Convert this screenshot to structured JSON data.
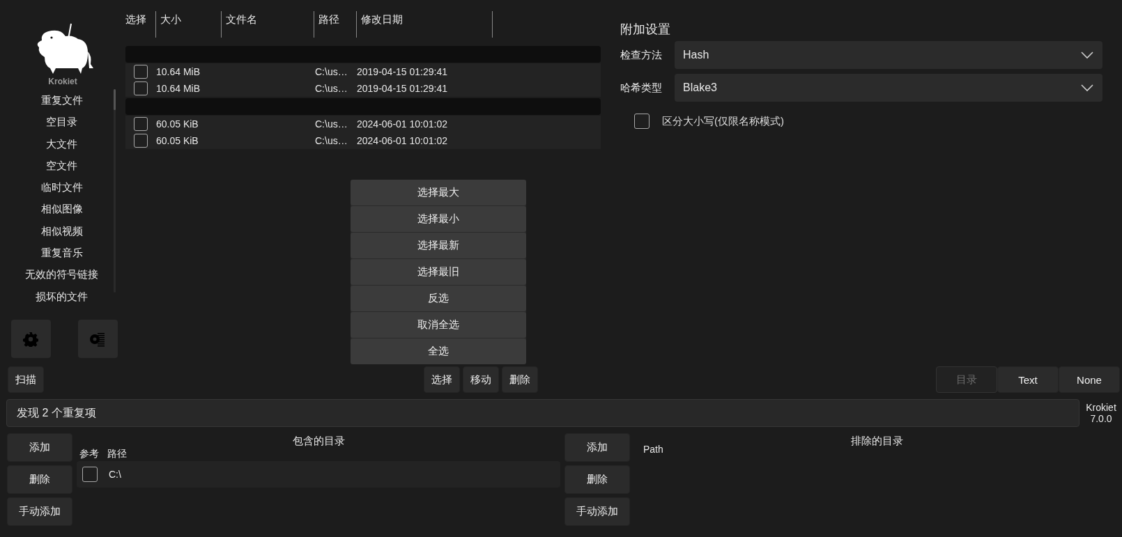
{
  "sidebar": {
    "logo_text": "Krokiet",
    "items": [
      {
        "label": "重复文件"
      },
      {
        "label": "空目录"
      },
      {
        "label": "大文件"
      },
      {
        "label": "空文件"
      },
      {
        "label": "临时文件"
      },
      {
        "label": "相似图像"
      },
      {
        "label": "相似视频"
      },
      {
        "label": "重复音乐"
      },
      {
        "label": "无效的符号链接"
      },
      {
        "label": "损坏的文件"
      }
    ]
  },
  "results_table": {
    "columns": [
      "选择",
      "大小",
      "文件名",
      "路径",
      "修改日期"
    ],
    "groups": [
      {
        "rows": [
          {
            "checked": false,
            "size": "10.64 MiB",
            "path": "C:\\us…",
            "modified": "2019-04-15 01:29:41"
          },
          {
            "checked": false,
            "size": "10.64 MiB",
            "path": "C:\\us…",
            "modified": "2019-04-15 01:29:41"
          }
        ]
      },
      {
        "rows": [
          {
            "checked": false,
            "size": "60.05 KiB",
            "path": "C:\\us…",
            "modified": "2024-06-01 10:01:02"
          },
          {
            "checked": false,
            "size": "60.05 KiB",
            "path": "C:\\us…",
            "modified": "2024-06-01 10:01:02"
          }
        ]
      }
    ]
  },
  "settings": {
    "title": "附加设置",
    "fields": [
      {
        "label": "检查方法",
        "value": "Hash"
      },
      {
        "label": "哈希类型",
        "value": "Blake3"
      }
    ],
    "case_sensitive": {
      "label": "区分大小写(仅限名称模式)",
      "checked": false
    }
  },
  "select_menu": {
    "items": [
      "选择最大",
      "选择最小",
      "选择最新",
      "选择最旧",
      "反选",
      "取消全选",
      "全选"
    ]
  },
  "action_bar": {
    "scan": "扫描",
    "actions": [
      "选择",
      "移动",
      "删除"
    ],
    "modes": [
      {
        "label": "目录",
        "disabled": true
      },
      {
        "label": "Text",
        "disabled": false
      },
      {
        "label": "None",
        "disabled": false
      }
    ]
  },
  "status": {
    "message": "发现 2 个重复项",
    "app_name": "Krokiet",
    "version": "7.0.0"
  },
  "included_dirs": {
    "buttons": [
      "添加",
      "删除",
      "手动添加"
    ],
    "title": "包含的目录",
    "columns": [
      "参考",
      "路径"
    ],
    "rows": [
      {
        "reference": false,
        "path": "C:\\"
      }
    ]
  },
  "excluded_dirs": {
    "buttons": [
      "添加",
      "删除",
      "手动添加"
    ],
    "title": "排除的目录",
    "columns": [
      "Path"
    ]
  }
}
